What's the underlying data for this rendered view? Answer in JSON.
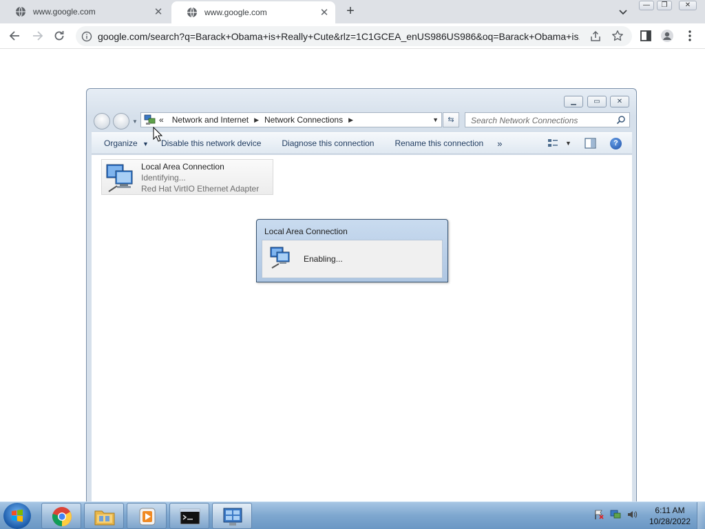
{
  "browser": {
    "tabs": [
      {
        "title": "www.google.com",
        "active": false
      },
      {
        "title": "www.google.com",
        "active": true
      }
    ],
    "new_tab_label": "+",
    "url": "google.com/search?q=Barack+Obama+is+Really+Cute&rlz=1C1GCEA_enUS986US986&oq=Barack+Obama+is..."
  },
  "explorer": {
    "breadcrumb": {
      "prefix": "«",
      "items": [
        "Network and Internet",
        "Network Connections"
      ]
    },
    "search_placeholder": "Search Network Connections",
    "commands": {
      "organize": "Organize",
      "disable": "Disable this network device",
      "diagnose": "Diagnose this connection",
      "rename": "Rename this connection",
      "more": "»"
    },
    "connection": {
      "name": "Local Area Connection",
      "status": "Identifying...",
      "adapter": "Red Hat VirtIO Ethernet Adapter"
    }
  },
  "dialog": {
    "title": "Local Area Connection",
    "status": "Enabling..."
  },
  "taskbar": {
    "time": "6:11 AM",
    "date": "10/28/2022",
    "apps": [
      "chrome",
      "windows-explorer",
      "media-player",
      "command-prompt",
      "network-connections"
    ]
  }
}
